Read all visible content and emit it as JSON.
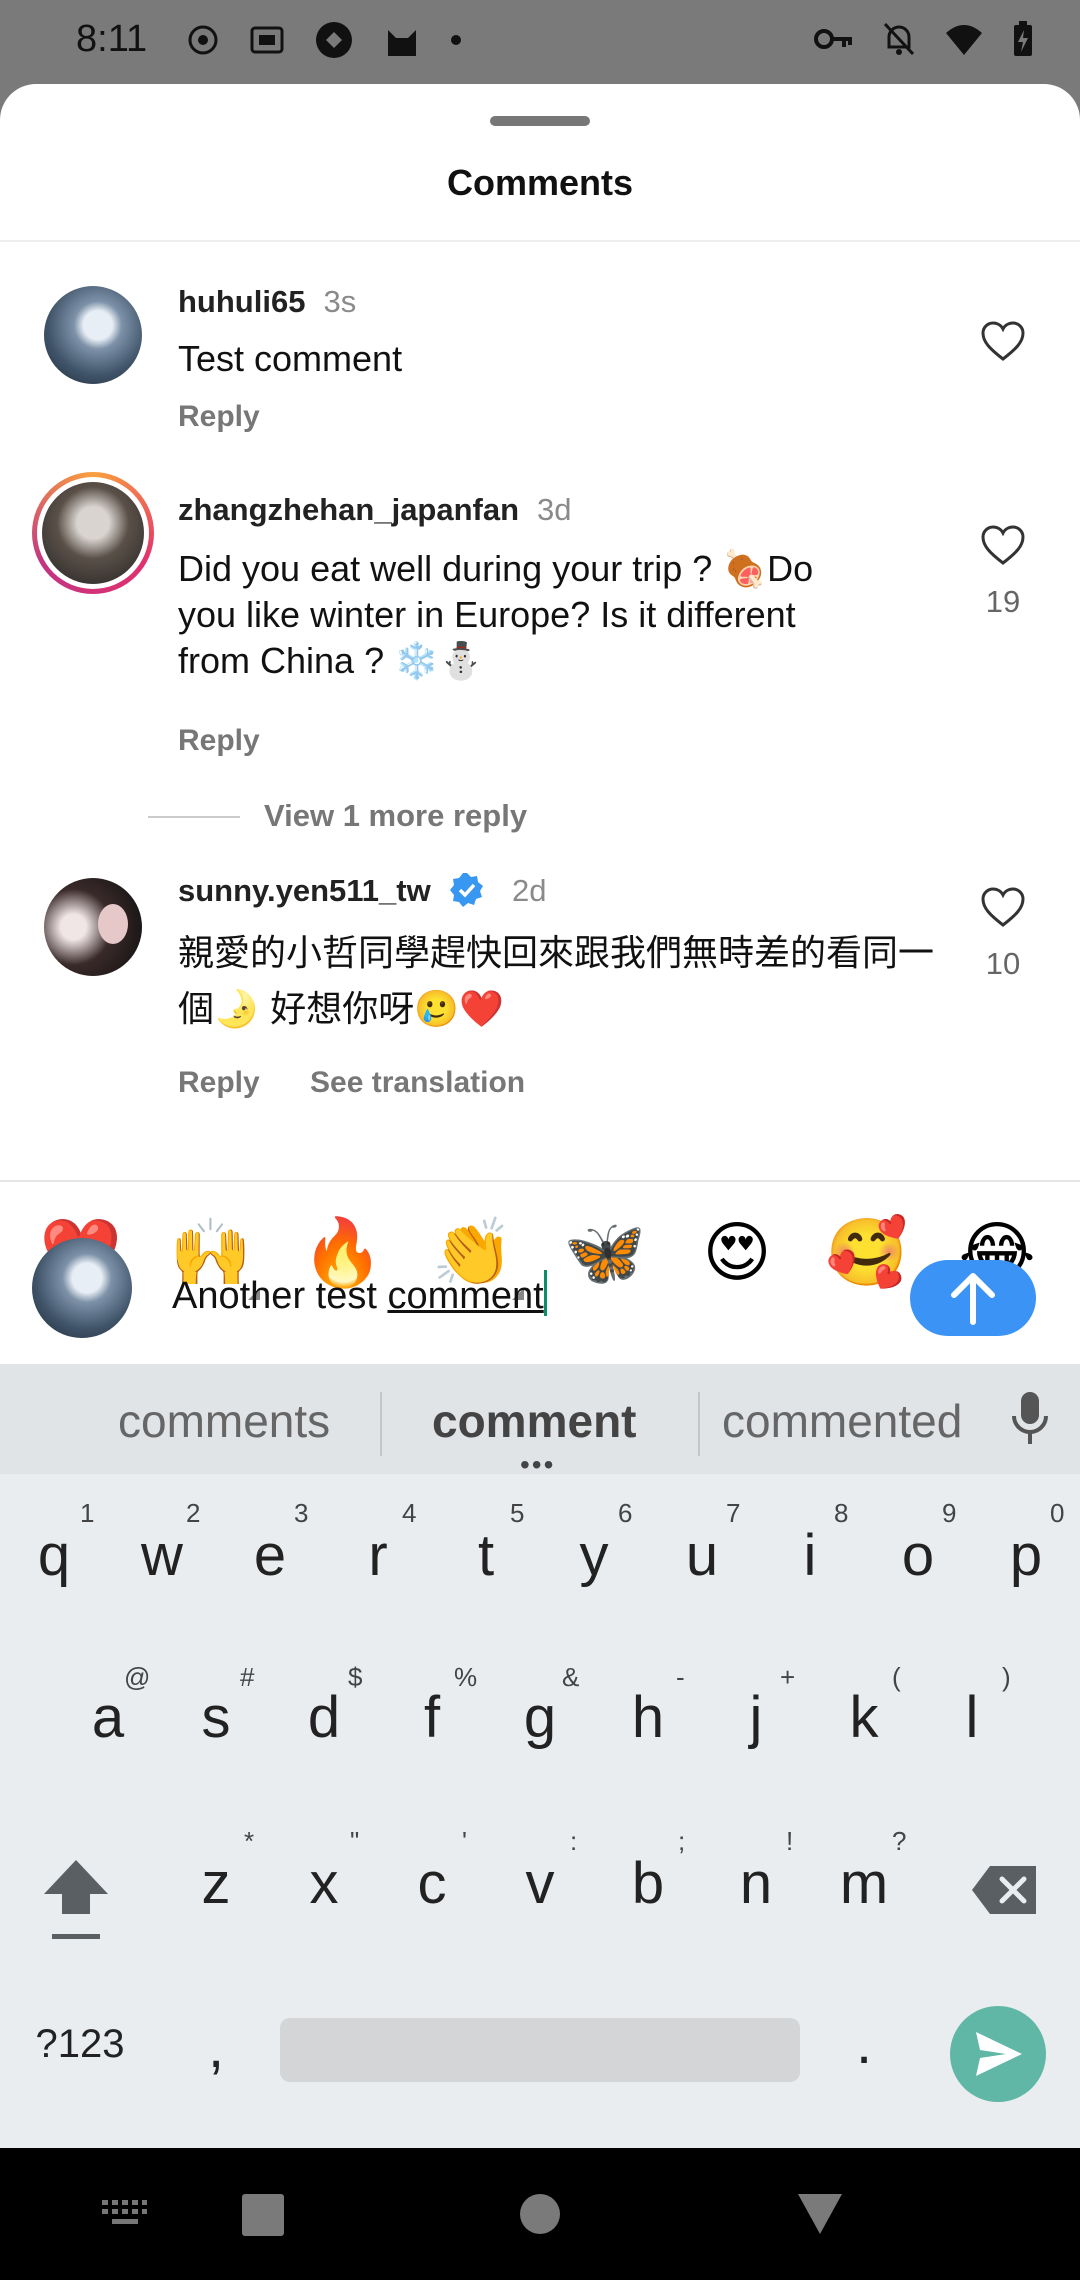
{
  "status_bar": {
    "time": "8:11",
    "left_icons": [
      "record-icon",
      "iqiyi-icon",
      "app-icon",
      "cat-icon",
      "dot-icon"
    ],
    "right_icons": [
      "key-icon",
      "bell-off-icon",
      "wifi-icon",
      "battery-icon"
    ]
  },
  "sheet": {
    "title": "Comments"
  },
  "comments": [
    {
      "username": "huhuli65",
      "time": "3s",
      "text": "Test comment",
      "reply": "Reply",
      "likes": ""
    },
    {
      "username": "zhangzhehan_japanfan",
      "time": "3d",
      "text": "Did you eat well during your trip ? 🍖Do you like winter in Europe? Is it different from China ? ❄️⛄",
      "reply": "Reply",
      "likes": "19",
      "view_more": "View 1 more reply"
    },
    {
      "username": "sunny.yen511_tw",
      "verified": true,
      "time": "2d",
      "text": "親愛的小哲同學趕快回來跟我們無時差的看同一個🌛 好想你呀🥲❤️",
      "reply": "Reply",
      "see_translation": "See translation",
      "likes": "10"
    }
  ],
  "quick_emojis": [
    "❤️",
    "🙌",
    "🔥",
    "👏",
    "🦋",
    "😍",
    "🥰",
    "😂"
  ],
  "composer": {
    "text_plain": "Another test ",
    "text_underlined": "comment"
  },
  "keyboard": {
    "suggestions": [
      "comments",
      "comment",
      "commented"
    ],
    "row1": [
      "q",
      "w",
      "e",
      "r",
      "t",
      "y",
      "u",
      "i",
      "o",
      "p"
    ],
    "row1_hints": [
      "1",
      "2",
      "3",
      "4",
      "5",
      "6",
      "7",
      "8",
      "9",
      "0"
    ],
    "row2": [
      "a",
      "s",
      "d",
      "f",
      "g",
      "h",
      "j",
      "k",
      "l"
    ],
    "row2_hints": [
      "@",
      "#",
      "$",
      "%",
      "&",
      "-",
      "+",
      "(",
      ")"
    ],
    "row3": [
      "z",
      "x",
      "c",
      "v",
      "b",
      "n",
      "m"
    ],
    "row3_hints": [
      "*",
      "\"",
      "'",
      ":",
      ";",
      "!",
      "?"
    ],
    "symbols_key": "?123",
    "comma": ",",
    "period": "."
  },
  "colors": {
    "accent_blue": "#3b93f5",
    "enter_green": "#60b7a6",
    "verified_blue": "#3897f0"
  }
}
